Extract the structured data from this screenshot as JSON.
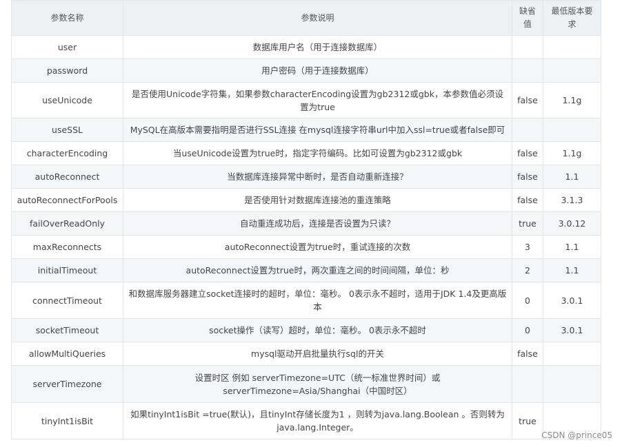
{
  "table": {
    "headers": [
      "参数名称",
      "参数说明",
      "缺省值",
      "最低版本要求"
    ],
    "rows": [
      {
        "name": "user",
        "desc": "数据库用户名（用于连接数据库）",
        "default": "",
        "version": ""
      },
      {
        "name": "password",
        "desc": "用户密码（用于连接数据库）",
        "default": "",
        "version": ""
      },
      {
        "name": "useUnicode",
        "desc": "是否使用Unicode字符集，如果参数characterEncoding设置为gb2312或gbk，本参数值必须设置为true",
        "default": "false",
        "version": "1.1g"
      },
      {
        "name": "useSSL",
        "desc": "MySQL在高版本需要指明是否进行SSL连接 在mysql连接字符串url中加入ssl=true或者false即可",
        "default": "",
        "version": ""
      },
      {
        "name": "characterEncoding",
        "desc": "当useUnicode设置为true时，指定字符编码。比如可设置为gb2312或gbk",
        "default": "false",
        "version": "1.1g"
      },
      {
        "name": "autoReconnect",
        "desc": "当数据库连接异常中断时，是否自动重新连接？",
        "default": "false",
        "version": "1.1"
      },
      {
        "name": "autoReconnectForPools",
        "desc": "是否使用针对数据库连接池的重连策略",
        "default": "false",
        "version": "3.1.3"
      },
      {
        "name": "failOverReadOnly",
        "desc": "自动重连成功后，连接是否设置为只读？",
        "default": "true",
        "version": "3.0.12"
      },
      {
        "name": "maxReconnects",
        "desc": "autoReconnect设置为true时，重试连接的次数",
        "default": "3",
        "version": "1.1"
      },
      {
        "name": "initialTimeout",
        "desc": "autoReconnect设置为true时，两次重连之间的时间间隔，单位：秒",
        "default": "2",
        "version": "1.1"
      },
      {
        "name": "connectTimeout",
        "desc": "和数据库服务器建立socket连接时的超时，单位：毫秒。 0表示永不超时，适用于JDK 1.4及更高版本",
        "default": "0",
        "version": "3.0.1"
      },
      {
        "name": "socketTimeout",
        "desc": "socket操作（读写）超时，单位：毫秒。 0表示永不超时",
        "default": "0",
        "version": "3.0.1"
      },
      {
        "name": "allowMultiQueries",
        "desc": "mysql驱动开启批量执行sql的开关",
        "default": "false",
        "version": ""
      },
      {
        "name": "serverTimezone",
        "desc": "设置时区 例如 serverTimezone=UTC（统一标准世界时间）或serverTimezone=Asia/Shanghai（中国时区）",
        "default": "",
        "version": ""
      },
      {
        "name": "tinyInt1isBit",
        "desc": "如果tinyInt1isBit =true(默认)，且tinyInt存储长度为1 ，则转为java.lang.Boolean 。否则转为java.lang.Integer。",
        "default": "true",
        "version": ""
      }
    ]
  },
  "watermark": "CSDN @prince05"
}
